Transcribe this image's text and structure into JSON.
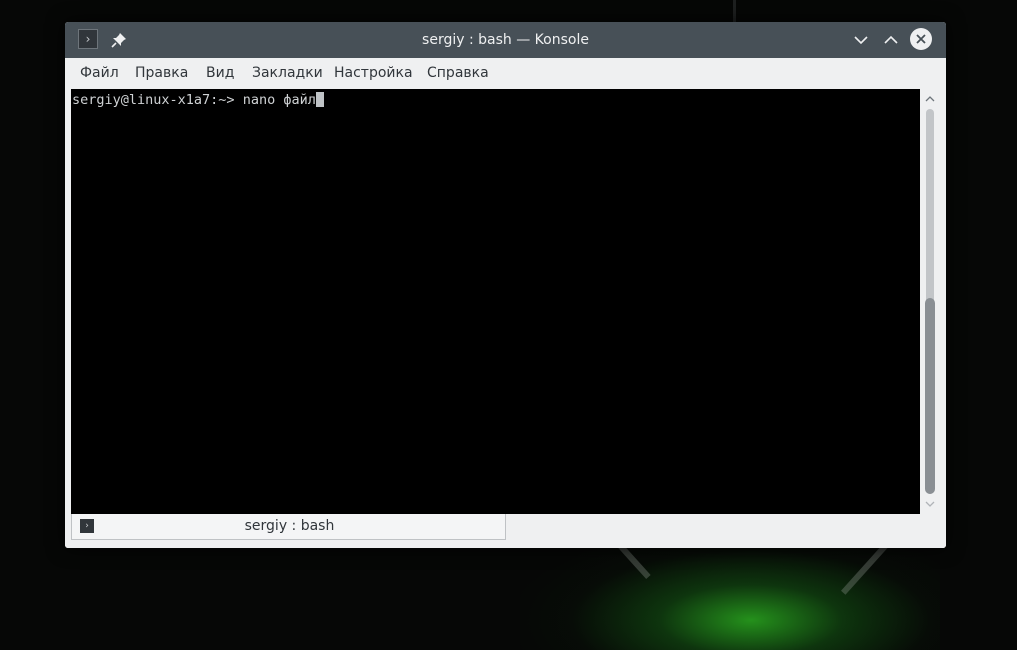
{
  "window": {
    "title": "sergiy : bash — Konsole",
    "icons": {
      "app": "terminal-prompt-icon",
      "pin": "pin-icon",
      "minimize": "chevron-down-icon",
      "maximize": "chevron-up-icon",
      "close": "close-icon"
    },
    "app_icon_glyph": "›"
  },
  "menu": {
    "items": [
      "Файл",
      "Правка",
      "Вид",
      "Закладки",
      "Настройка",
      "Справка"
    ]
  },
  "terminal": {
    "prompt": "sergiy@linux-x1a7:~> ",
    "command": "nano файл"
  },
  "scrollbar": {
    "position_fraction": 0.53,
    "visible_fraction": 0.51
  },
  "tabs": [
    {
      "label": "sergiy : bash",
      "icon": "terminal-prompt-icon",
      "icon_glyph": "›"
    }
  ],
  "colors": {
    "titlebar": "#475057",
    "window_bg": "#eff0f1",
    "terminal_bg": "#000000",
    "terminal_fg": "#cfd2d4"
  }
}
